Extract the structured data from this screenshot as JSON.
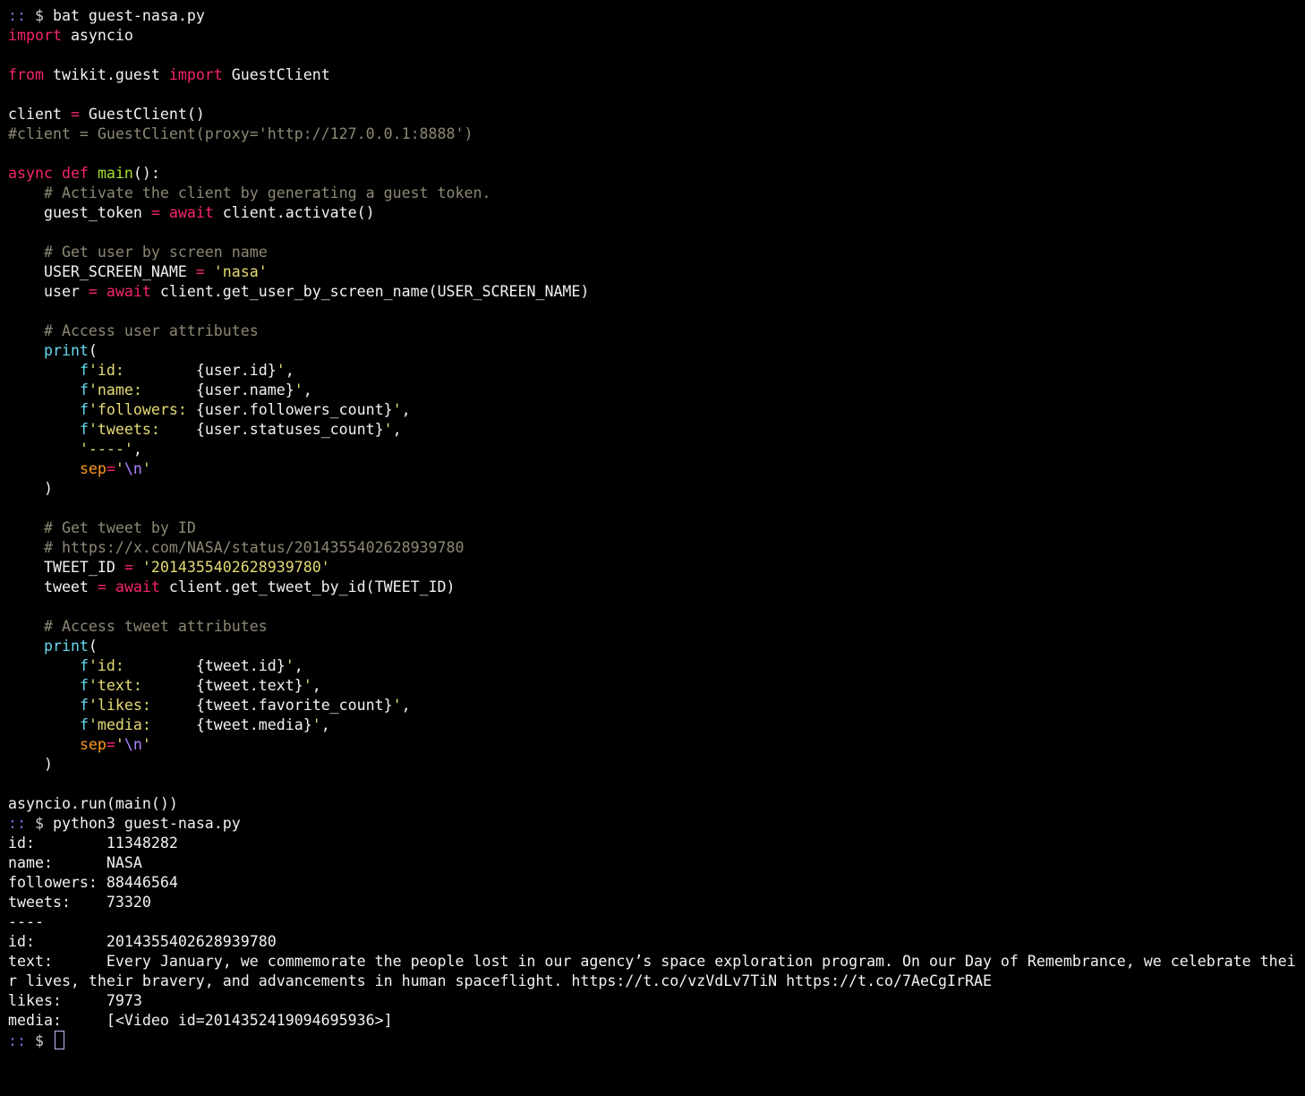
{
  "terminal": {
    "lines": [
      [
        [
          "prompt",
          ":: "
        ],
        [
          "dollar",
          "$ "
        ],
        [
          "plain",
          "bat guest-nasa.py"
        ]
      ],
      [
        [
          "keyword",
          "import"
        ],
        [
          "plain",
          " asyncio"
        ]
      ],
      [],
      [
        [
          "keyword",
          "from"
        ],
        [
          "plain",
          " twikit.guest "
        ],
        [
          "keyword",
          "import"
        ],
        [
          "plain",
          " GuestClient"
        ]
      ],
      [],
      [
        [
          "plain",
          "client "
        ],
        [
          "op",
          "="
        ],
        [
          "plain",
          " GuestClient()"
        ]
      ],
      [
        [
          "comment",
          "#client = GuestClient(proxy='http://127.0.0.1:8888')"
        ]
      ],
      [],
      [
        [
          "keyword",
          "async"
        ],
        [
          "plain",
          " "
        ],
        [
          "keyword",
          "def"
        ],
        [
          "plain",
          " "
        ],
        [
          "func",
          "main"
        ],
        [
          "plain",
          "():"
        ]
      ],
      [
        [
          "plain",
          "    "
        ],
        [
          "comment",
          "# Activate the client by generating a guest token."
        ]
      ],
      [
        [
          "plain",
          "    guest_token "
        ],
        [
          "op",
          "="
        ],
        [
          "plain",
          " "
        ],
        [
          "keyword",
          "await"
        ],
        [
          "plain",
          " client.activate()"
        ]
      ],
      [],
      [
        [
          "plain",
          "    "
        ],
        [
          "comment",
          "# Get user by screen name"
        ]
      ],
      [
        [
          "plain",
          "    USER_SCREEN_NAME "
        ],
        [
          "op",
          "="
        ],
        [
          "plain",
          " "
        ],
        [
          "string",
          "'nasa'"
        ]
      ],
      [
        [
          "plain",
          "    user "
        ],
        [
          "op",
          "="
        ],
        [
          "plain",
          " "
        ],
        [
          "keyword",
          "await"
        ],
        [
          "plain",
          " client.get_user_by_screen_name(USER_SCREEN_NAME)"
        ]
      ],
      [],
      [
        [
          "plain",
          "    "
        ],
        [
          "comment",
          "# Access user attributes"
        ]
      ],
      [
        [
          "plain",
          "    "
        ],
        [
          "builtin",
          "print"
        ],
        [
          "plain",
          "("
        ]
      ],
      [
        [
          "plain",
          "        "
        ],
        [
          "fprefix",
          "f"
        ],
        [
          "string",
          "'id:        "
        ],
        [
          "plain",
          "{user.id}"
        ],
        [
          "string",
          "'"
        ],
        [
          "plain",
          ","
        ]
      ],
      [
        [
          "plain",
          "        "
        ],
        [
          "fprefix",
          "f"
        ],
        [
          "string",
          "'name:      "
        ],
        [
          "plain",
          "{user.name}"
        ],
        [
          "string",
          "'"
        ],
        [
          "plain",
          ","
        ]
      ],
      [
        [
          "plain",
          "        "
        ],
        [
          "fprefix",
          "f"
        ],
        [
          "string",
          "'followers: "
        ],
        [
          "plain",
          "{user.followers_count}"
        ],
        [
          "string",
          "'"
        ],
        [
          "plain",
          ","
        ]
      ],
      [
        [
          "plain",
          "        "
        ],
        [
          "fprefix",
          "f"
        ],
        [
          "string",
          "'tweets:    "
        ],
        [
          "plain",
          "{user.statuses_count}"
        ],
        [
          "string",
          "'"
        ],
        [
          "plain",
          ","
        ]
      ],
      [
        [
          "plain",
          "        "
        ],
        [
          "string",
          "'----'"
        ],
        [
          "plain",
          ","
        ]
      ],
      [
        [
          "plain",
          "        "
        ],
        [
          "param",
          "sep"
        ],
        [
          "op",
          "="
        ],
        [
          "string",
          "'"
        ],
        [
          "escape",
          "\\n"
        ],
        [
          "string",
          "'"
        ]
      ],
      [
        [
          "plain",
          "    )"
        ]
      ],
      [],
      [
        [
          "plain",
          "    "
        ],
        [
          "comment",
          "# Get tweet by ID"
        ]
      ],
      [
        [
          "plain",
          "    "
        ],
        [
          "comment",
          "# https://x.com/NASA/status/2014355402628939780"
        ]
      ],
      [
        [
          "plain",
          "    TWEET_ID "
        ],
        [
          "op",
          "="
        ],
        [
          "plain",
          " "
        ],
        [
          "string",
          "'2014355402628939780'"
        ]
      ],
      [
        [
          "plain",
          "    tweet "
        ],
        [
          "op",
          "="
        ],
        [
          "plain",
          " "
        ],
        [
          "keyword",
          "await"
        ],
        [
          "plain",
          " client.get_tweet_by_id(TWEET_ID)"
        ]
      ],
      [],
      [
        [
          "plain",
          "    "
        ],
        [
          "comment",
          "# Access tweet attributes"
        ]
      ],
      [
        [
          "plain",
          "    "
        ],
        [
          "builtin",
          "print"
        ],
        [
          "plain",
          "("
        ]
      ],
      [
        [
          "plain",
          "        "
        ],
        [
          "fprefix",
          "f"
        ],
        [
          "string",
          "'id:        "
        ],
        [
          "plain",
          "{tweet.id}"
        ],
        [
          "string",
          "'"
        ],
        [
          "plain",
          ","
        ]
      ],
      [
        [
          "plain",
          "        "
        ],
        [
          "fprefix",
          "f"
        ],
        [
          "string",
          "'text:      "
        ],
        [
          "plain",
          "{tweet.text}"
        ],
        [
          "string",
          "'"
        ],
        [
          "plain",
          ","
        ]
      ],
      [
        [
          "plain",
          "        "
        ],
        [
          "fprefix",
          "f"
        ],
        [
          "string",
          "'likes:     "
        ],
        [
          "plain",
          "{tweet.favorite_count}"
        ],
        [
          "string",
          "'"
        ],
        [
          "plain",
          ","
        ]
      ],
      [
        [
          "plain",
          "        "
        ],
        [
          "fprefix",
          "f"
        ],
        [
          "string",
          "'media:     "
        ],
        [
          "plain",
          "{tweet.media}"
        ],
        [
          "string",
          "'"
        ],
        [
          "plain",
          ","
        ]
      ],
      [
        [
          "plain",
          "        "
        ],
        [
          "param",
          "sep"
        ],
        [
          "op",
          "="
        ],
        [
          "string",
          "'"
        ],
        [
          "escape",
          "\\n"
        ],
        [
          "string",
          "'"
        ]
      ],
      [
        [
          "plain",
          "    )"
        ]
      ],
      [],
      [
        [
          "plain",
          "asyncio.run(main())"
        ]
      ],
      [
        [
          "prompt",
          ":: "
        ],
        [
          "dollar",
          "$ "
        ],
        [
          "plain",
          "python3 guest-nasa.py"
        ]
      ],
      [
        [
          "output",
          "id:        11348282"
        ]
      ],
      [
        [
          "output",
          "name:      NASA"
        ]
      ],
      [
        [
          "output",
          "followers: 88446564"
        ]
      ],
      [
        [
          "output",
          "tweets:    73320"
        ]
      ],
      [
        [
          "output",
          "----"
        ]
      ],
      [
        [
          "output",
          "id:        2014355402628939780"
        ]
      ],
      [
        [
          "output",
          "text:      Every January, we commemorate the people lost in our agency’s space exploration program. On our Day of Remembrance, we celebrate thei"
        ]
      ],
      [
        [
          "output",
          "r lives, their bravery, and advancements in human spaceflight. https://t.co/vzVdLv7TiN https://t.co/7AeCgIrRAE"
        ]
      ],
      [
        [
          "output",
          "likes:     7973"
        ]
      ],
      [
        [
          "output",
          "media:     [<Video id=2014352419094695936>]"
        ]
      ],
      [
        [
          "prompt",
          ":: "
        ],
        [
          "dollar",
          "$ "
        ]
      ]
    ]
  }
}
